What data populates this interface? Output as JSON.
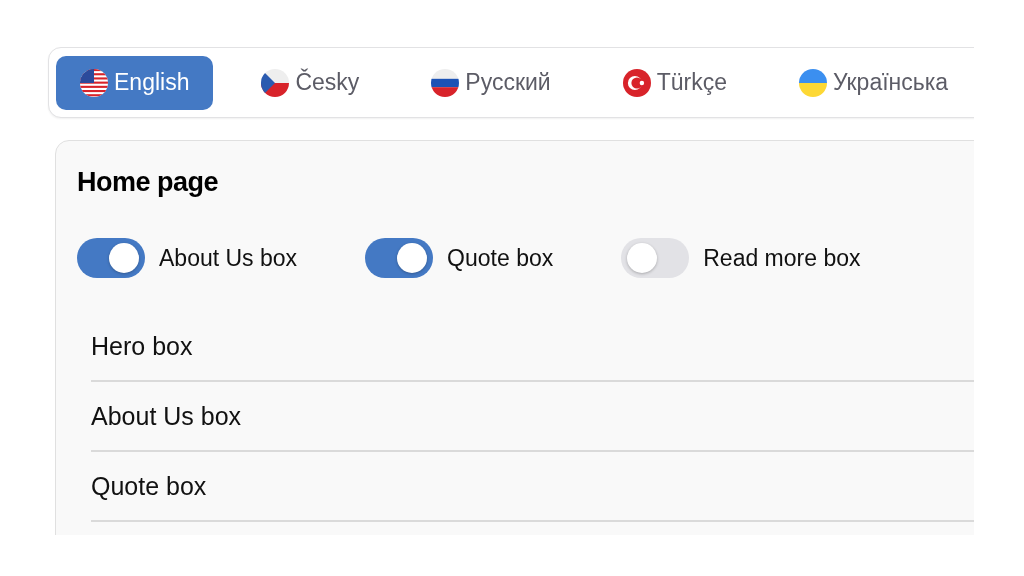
{
  "languages": [
    {
      "label": "English",
      "kind": "us",
      "selected": true
    },
    {
      "label": "Česky",
      "kind": "cz",
      "selected": false
    },
    {
      "label": "Русский",
      "kind": "ru",
      "selected": false
    },
    {
      "label": "Türkçe",
      "kind": "tr",
      "selected": false
    },
    {
      "label": "Українська",
      "kind": "ua",
      "selected": false
    }
  ],
  "section": {
    "title": "Home page",
    "toggles": [
      {
        "label": "About Us box",
        "on": true
      },
      {
        "label": "Quote box",
        "on": true
      },
      {
        "label": "Read more box",
        "on": false
      }
    ],
    "list": [
      {
        "label": "Hero box"
      },
      {
        "label": "About Us box"
      },
      {
        "label": "Quote box"
      }
    ]
  }
}
